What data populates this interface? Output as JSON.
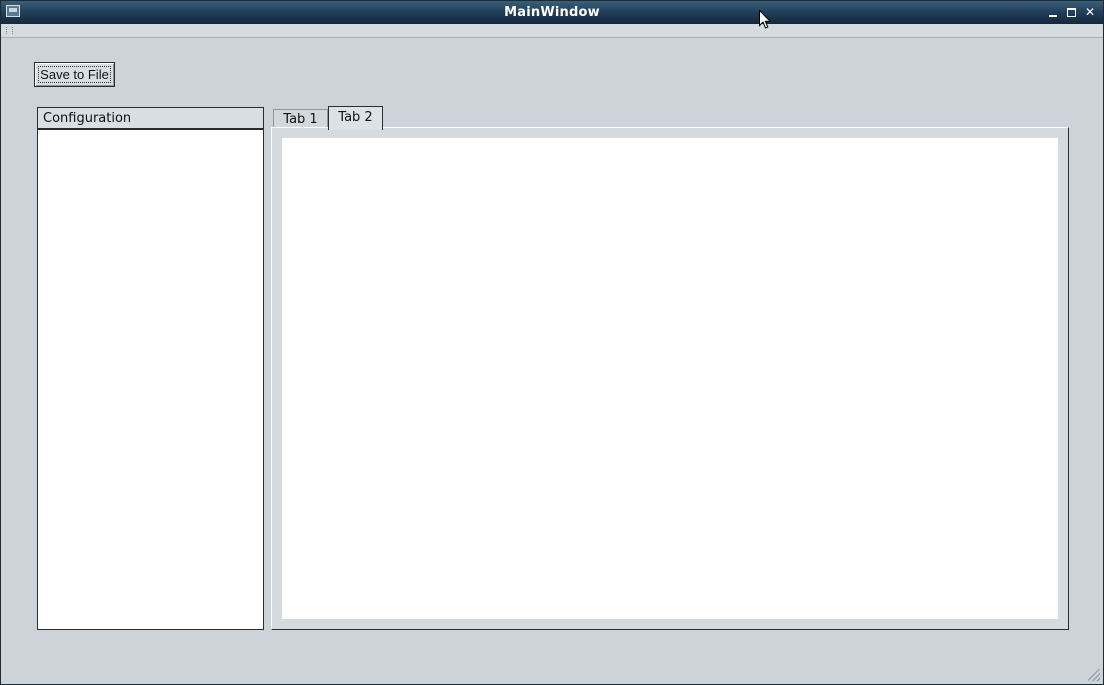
{
  "window": {
    "title": "MainWindow"
  },
  "toolbar": {
    "save_label": "Save to File"
  },
  "tree": {
    "header": "Configuration"
  },
  "tabs": [
    {
      "label": "Tab 1",
      "selected": false
    },
    {
      "label": "Tab 2",
      "selected": true
    }
  ],
  "icons": {
    "app": "app-window-icon",
    "minimize": "minimize-icon",
    "maximize": "maximize-icon",
    "close": "close-icon",
    "cursor": "mouse-pointer-icon",
    "grip": "resize-grip-icon"
  },
  "colors": {
    "title_bar": "#23405a",
    "window_bg": "#cdd3d8",
    "pane_bg": "#ffffff"
  }
}
